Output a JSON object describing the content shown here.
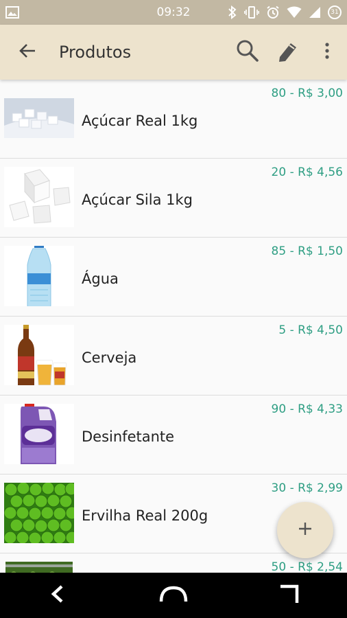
{
  "status_bar": {
    "time": "09:32",
    "battery_level": "31",
    "icons": [
      "image-icon",
      "bluetooth-icon",
      "vibrate-icon",
      "alarm-icon",
      "wifi-icon",
      "signal-icon",
      "battery-icon"
    ]
  },
  "app_bar": {
    "title": "Produtos",
    "icons": [
      "back-arrow-icon",
      "search-icon",
      "edit-icon",
      "more-vert-icon"
    ]
  },
  "products": [
    {
      "name": "Açúcar Real 1kg",
      "info": "80 - R$ 3,00",
      "image": "sugar-cubes-pile"
    },
    {
      "name": "Açúcar Sila 1kg",
      "info": "20 - R$ 4,56",
      "image": "sugar-cubes"
    },
    {
      "name": "Água",
      "info": "85 - R$ 1,50",
      "image": "water-bottle"
    },
    {
      "name": "Cerveja",
      "info": "5 - R$ 4,50",
      "image": "beer-bottle-and-glasses"
    },
    {
      "name": "Desinfetante",
      "info": "90 - R$ 4,33",
      "image": "disinfectant-jug"
    },
    {
      "name": "Ervilha Real 200g",
      "info": "30 - R$ 2,99",
      "image": "green-peas"
    },
    {
      "name": "",
      "info": "50 - R$ 2,54",
      "image": "green-peas-can"
    }
  ],
  "fab": {
    "icon": "plus-icon"
  },
  "nav_bar": {
    "icons": [
      "nav-back-icon",
      "nav-home-icon",
      "nav-recents-icon"
    ]
  },
  "colors": {
    "status_bar": "#c2b8a3",
    "app_bar": "#ede3cd",
    "accent_text": "#2e9e83",
    "fab": "#ede3cd"
  }
}
